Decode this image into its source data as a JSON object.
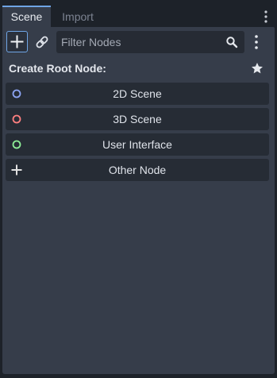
{
  "tabs": [
    {
      "label": "Scene",
      "active": true
    },
    {
      "label": "Import",
      "active": false
    }
  ],
  "toolbar": {
    "add_icon": "plus-icon",
    "link_icon": "link-icon",
    "filter_placeholder": "Filter Nodes",
    "filter_value": "",
    "search_icon": "search-icon",
    "more_icon": "vertical-ellipsis-icon"
  },
  "create_root": {
    "heading": "Create Root Node:",
    "favorites_icon": "star-icon",
    "options": [
      {
        "label": "2D Scene",
        "icon": "circle-outline-icon",
        "color": "#8da5f3"
      },
      {
        "label": "3D Scene",
        "icon": "circle-outline-icon",
        "color": "#fc7f7f"
      },
      {
        "label": "User Interface",
        "icon": "circle-outline-icon",
        "color": "#8eef97"
      },
      {
        "label": "Other Node",
        "icon": "plus-icon",
        "color": "#e0e0e0"
      }
    ]
  },
  "colors": {
    "background": "#1d2229",
    "panel": "#363d4a",
    "button": "#262c35",
    "accent": "#6fa5e5"
  }
}
